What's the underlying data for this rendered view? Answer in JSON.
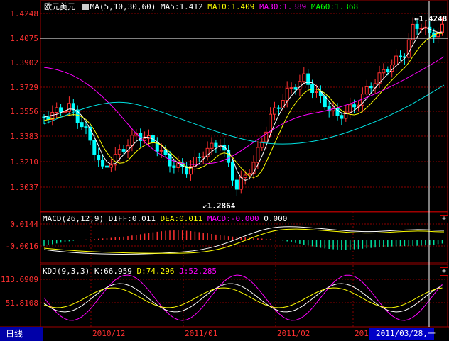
{
  "kline": {
    "title": "欧元美元",
    "ma_label": "MA(5,10,30,60)",
    "ma5": "MA5:1.412",
    "ma10": "MA10:1.409",
    "ma30": "MA30:1.389",
    "ma60": "MA60:1.368",
    "y_ticks": [
      "1.4248",
      "1.4075",
      "1.3902",
      "1.3729",
      "1.3556",
      "1.3383",
      "1.3210",
      "1.3037"
    ],
    "high_marker": "1.4248",
    "low_marker": "1.2864"
  },
  "macd": {
    "label": "MACD(26,12,9)",
    "diff": "DIFF:0.011",
    "dea": "DEA:0.011",
    "macd": "MACD:-0.000",
    "extra": "0.000",
    "y_ticks": [
      "0.0144",
      "-0.0016"
    ]
  },
  "kdj": {
    "label": "KDJ(9,3,3)",
    "k": "K:66.959",
    "d": "D:74.296",
    "j": "J:52.285",
    "y_ticks": [
      "113.6909",
      "51.8108"
    ]
  },
  "footer": {
    "period_tab": "日线",
    "x_ticks": [
      "2010/12",
      "2011/01",
      "2011/02",
      "201"
    ],
    "cursor_date": "2011/03/28,一"
  },
  "colors": {
    "up": "#ff3030",
    "down": "#00ffff",
    "ma5": "#ffffff",
    "ma10": "#ffff00",
    "ma30": "#ff00ff",
    "ma60": "#00ff00",
    "grid": "#8b0000"
  }
}
